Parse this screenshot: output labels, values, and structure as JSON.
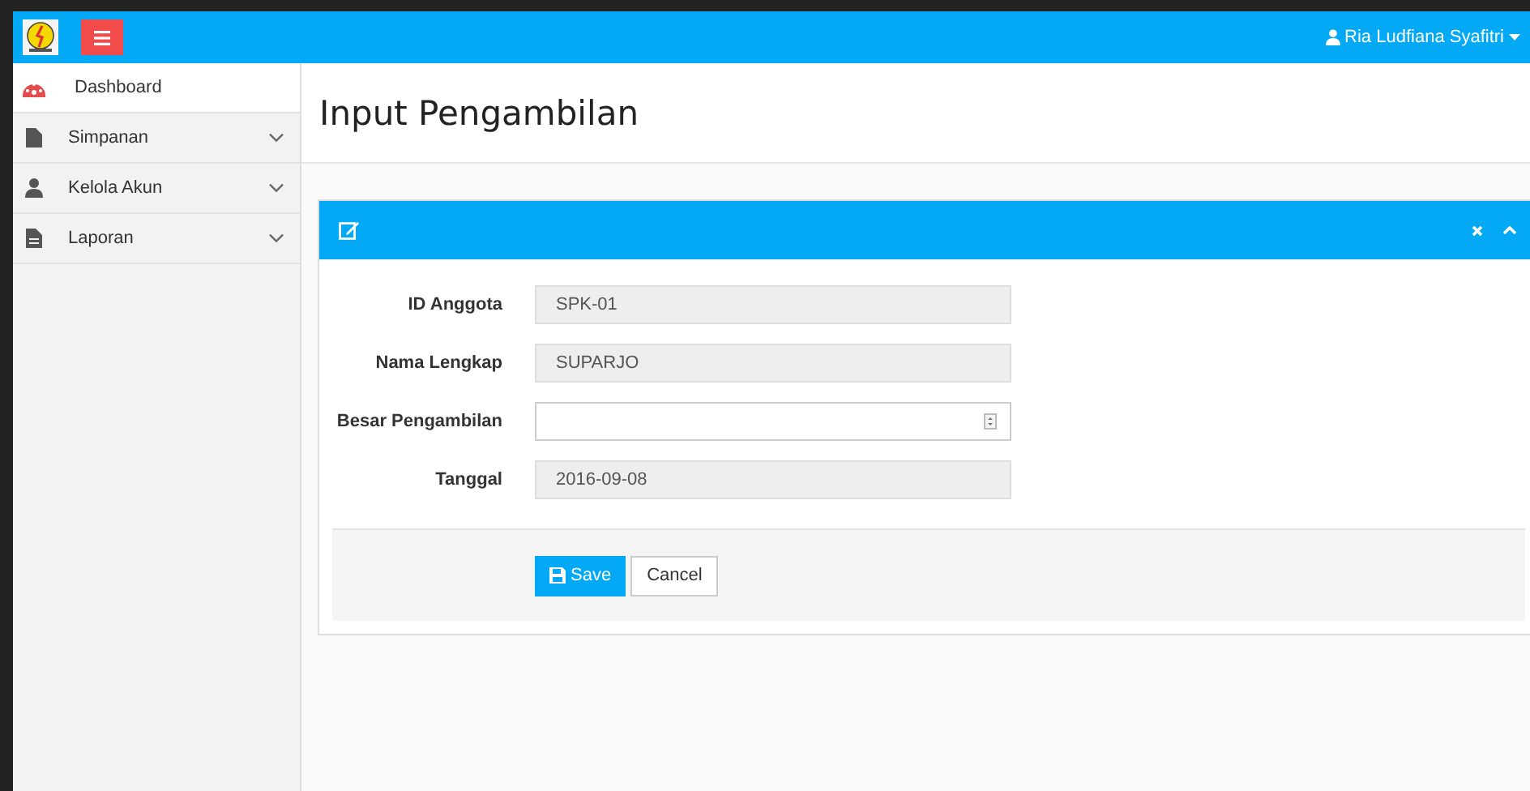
{
  "topbar": {
    "user": "Ria Ludfiana Syafitri"
  },
  "sidebar": {
    "items": [
      {
        "label": "Dashboard",
        "kind": "dashboard",
        "selected": true,
        "expandable": false
      },
      {
        "label": "Simpanan",
        "kind": "file",
        "selected": false,
        "expandable": true
      },
      {
        "label": "Kelola Akun",
        "kind": "user",
        "selected": false,
        "expandable": true
      },
      {
        "label": "Laporan",
        "kind": "report",
        "selected": false,
        "expandable": true
      }
    ]
  },
  "page": {
    "title": "Input Pengambilan"
  },
  "form": {
    "fields": [
      {
        "label": "ID Anggota",
        "value": "SPK-01",
        "kind": "readonly"
      },
      {
        "label": "Nama Lengkap",
        "value": "SUPARJO",
        "kind": "readonly"
      },
      {
        "label": "Besar Pengambilan",
        "kind": "number"
      },
      {
        "label": "Tanggal",
        "value": "2016-09-08",
        "kind": "readonly"
      }
    ],
    "buttons": [
      {
        "label": "Save",
        "kind": "primary"
      },
      {
        "label": "Cancel",
        "kind": "default"
      }
    ]
  }
}
